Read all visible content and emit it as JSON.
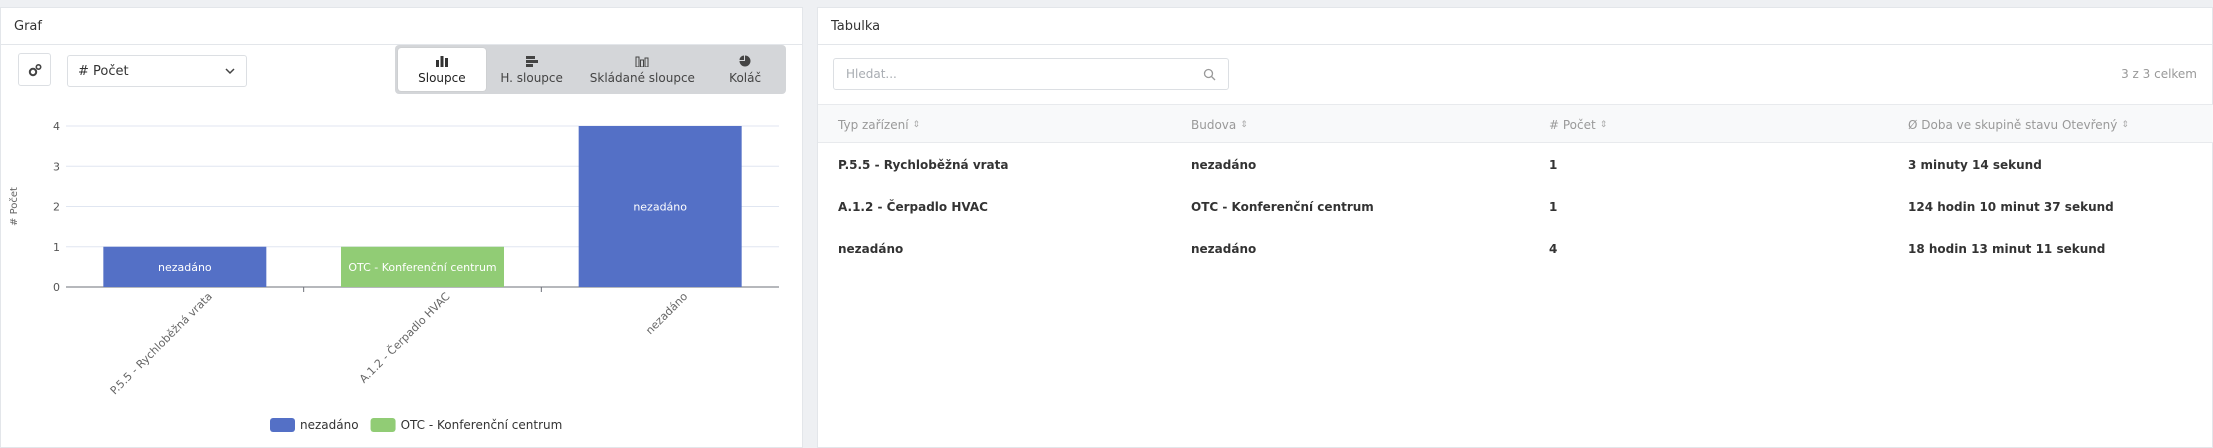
{
  "left_panel": {
    "title": "Graf",
    "select_value": "# Počet",
    "chart_types": [
      {
        "label": "Sloupce",
        "icon": "bar-chart-icon",
        "active": true
      },
      {
        "label": "H. sloupce",
        "icon": "horizontal-bar-chart-icon",
        "active": false
      },
      {
        "label": "Skládané sloupce",
        "icon": "stacked-bar-chart-icon",
        "active": false
      },
      {
        "label": "Koláč",
        "icon": "pie-chart-icon",
        "active": false
      }
    ]
  },
  "chart_data": {
    "type": "bar",
    "categories": [
      "P.5.5 - Rychloběžná vrata",
      "A.1.2 - Čerpadlo HVAC",
      "nezadáno"
    ],
    "values": [
      1,
      1,
      4
    ],
    "bar_labels": [
      "nezadáno",
      "OTC - Konferenční centrum",
      "nezadáno"
    ],
    "bar_colors": [
      "#5470c6",
      "#91cc75",
      "#5470c6"
    ],
    "ylabel": "# Počet",
    "xlabel": "",
    "ylim": [
      0,
      4
    ],
    "yticks": [
      "0",
      "1",
      "2",
      "3",
      "4"
    ],
    "legend": [
      {
        "name": "nezadáno",
        "color": "#5470c6"
      },
      {
        "name": "OTC - Konferenční centrum",
        "color": "#91cc75"
      }
    ],
    "legend_position": "bottom",
    "grid": true
  },
  "right_panel": {
    "title": "Tabulka",
    "search_placeholder": "Hledat...",
    "count_label": "3 z 3 celkem",
    "columns": [
      "Typ zařízení",
      "Budova",
      "# Počet",
      "Ø Doba ve skupině stavu Otevřený"
    ],
    "rows": [
      [
        "P.5.5 - Rychloběžná vrata",
        "nezadáno",
        "1",
        "3 minuty 14 sekund"
      ],
      [
        "A.1.2 - Čerpadlo HVAC",
        "OTC - Konferenční centrum",
        "1",
        "124 hodin 10 minut 37 sekund"
      ],
      [
        "nezadáno",
        "nezadáno",
        "4",
        "18 hodin 13 minut 11 sekund"
      ]
    ]
  }
}
